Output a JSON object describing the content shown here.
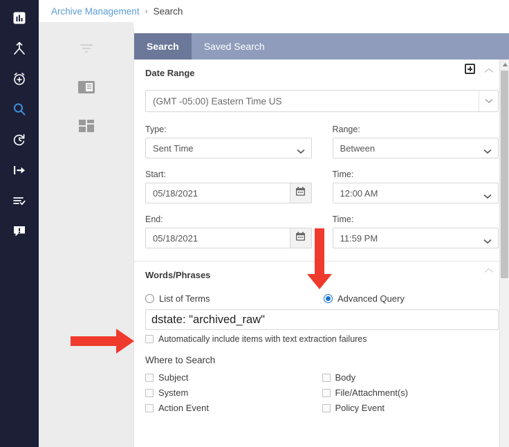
{
  "breadcrumb": {
    "root": "Archive Management",
    "separator": "›",
    "current": "Search"
  },
  "rail": {
    "items": [
      {
        "name": "dashboard-icon",
        "label": "Dashboard",
        "active": false
      },
      {
        "name": "workflow-icon",
        "label": "Workflow",
        "active": false
      },
      {
        "name": "alarm-add-icon",
        "label": "New Alert",
        "active": false
      },
      {
        "name": "search-icon",
        "label": "Search",
        "active": true
      },
      {
        "name": "history-icon",
        "label": "History",
        "active": false
      },
      {
        "name": "export-icon",
        "label": "Export",
        "active": false
      },
      {
        "name": "task-list-icon",
        "label": "Tasks",
        "active": false
      },
      {
        "name": "notification-icon",
        "label": "Notifications",
        "active": false
      }
    ]
  },
  "panel2": {
    "items": [
      {
        "name": "filter-icon",
        "label": "Filter"
      },
      {
        "name": "reading-pane-icon",
        "label": "Reading Pane"
      },
      {
        "name": "grid-layout-icon",
        "label": "Grid Layout"
      }
    ]
  },
  "tabs": [
    {
      "label": "Search",
      "active": true
    },
    {
      "label": "Saved Search",
      "active": false
    }
  ],
  "date_range": {
    "title": "Date Range",
    "timezone": "(GMT -05:00) Eastern Time US",
    "type_label": "Type:",
    "type_value": "Sent Time",
    "range_label": "Range:",
    "range_value": "Between",
    "start_label": "Start:",
    "start_value": "05/18/2021",
    "start_time_label": "Time:",
    "start_time_value": "12:00 AM",
    "end_label": "End:",
    "end_value": "05/18/2021",
    "end_time_label": "Time:",
    "end_time_value": "11:59 PM"
  },
  "words_phrases": {
    "title": "Words/Phrases",
    "radio_list_of_terms": "List of Terms",
    "radio_advanced_query": "Advanced Query",
    "selected_mode": "Advanced Query",
    "query_value": "dstate: \"archived_raw\"",
    "extraction_failures_label": "Automatically include items with text extraction failures",
    "extraction_failures_checked": false
  },
  "where_to_search": {
    "title": "Where to Search",
    "options": [
      {
        "label": "Subject",
        "checked": false
      },
      {
        "label": "Body",
        "checked": false
      },
      {
        "label": "System",
        "checked": false
      },
      {
        "label": "File/Attachment(s)",
        "checked": false
      },
      {
        "label": "Action Event",
        "checked": false
      },
      {
        "label": "Policy Event",
        "checked": false
      }
    ]
  },
  "colors": {
    "rail_bg": "#1c1f36",
    "panel2_bg": "#ececec",
    "tab_active": "#6b7899",
    "tab_bar": "#8f9cbb",
    "accent_link": "#5b9bd5",
    "radio_accent": "#1573d6",
    "annotation_red": "#ef3b2d"
  },
  "annotations": [
    {
      "name": "arrow-down-advanced-query",
      "direction": "down",
      "color": "#ef3b2d"
    },
    {
      "name": "arrow-right-query-input",
      "direction": "right",
      "color": "#ef3b2d"
    }
  ]
}
